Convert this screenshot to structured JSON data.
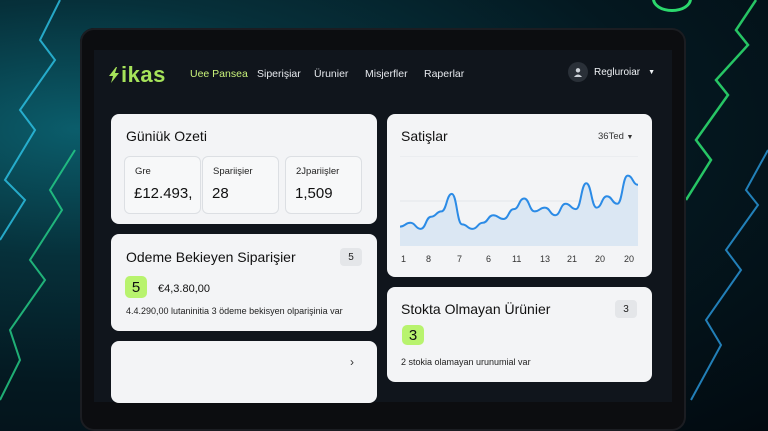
{
  "brand": {
    "name": "ikas",
    "accent": "#a6e35a"
  },
  "nav": [
    {
      "label": "Uee Pansea",
      "active": true
    },
    {
      "label": "Siperişiar"
    },
    {
      "label": "Ürunier"
    },
    {
      "label": "Misjerfler"
    },
    {
      "label": "Raperlar"
    }
  ],
  "user": {
    "label": "Regluroiar",
    "icon": "user-icon"
  },
  "summary": {
    "title": "Güniük Ozeti",
    "kpis": [
      {
        "label": "Gre",
        "value": "£12.493,"
      },
      {
        "label": "Spariişier",
        "value": "28"
      },
      {
        "label": "2Jpariişler",
        "value": "1,509"
      }
    ]
  },
  "sales": {
    "title": "Satişlar",
    "range": "36Ted"
  },
  "pending": {
    "title": "Odeme Bekieyen Siparişier",
    "count": "5",
    "badge": "5",
    "amount": "€4,3.80,00",
    "note": "4.4.290,00 lutaninitia 3 ödeme bekisyen olparişinia var"
  },
  "stock": {
    "title": "Stokta Olmayan Ürünier",
    "count": "3",
    "badge": "3",
    "note": "2 stokia olamayan urunumial var"
  },
  "extra_card": {
    "arrow": "›"
  },
  "chart_data": {
    "type": "area",
    "x_ticks": [
      "1",
      "8",
      "7",
      "6",
      "11",
      "13",
      "21",
      "20",
      "20"
    ],
    "values": [
      0.15,
      0.2,
      0.12,
      0.28,
      0.35,
      0.58,
      0.18,
      0.12,
      0.2,
      0.3,
      0.25,
      0.38,
      0.52,
      0.35,
      0.4,
      0.3,
      0.45,
      0.38,
      0.72,
      0.4,
      0.55,
      0.45,
      0.82,
      0.7
    ],
    "color": "#2b8be6",
    "fill": "#dbe7f3"
  }
}
